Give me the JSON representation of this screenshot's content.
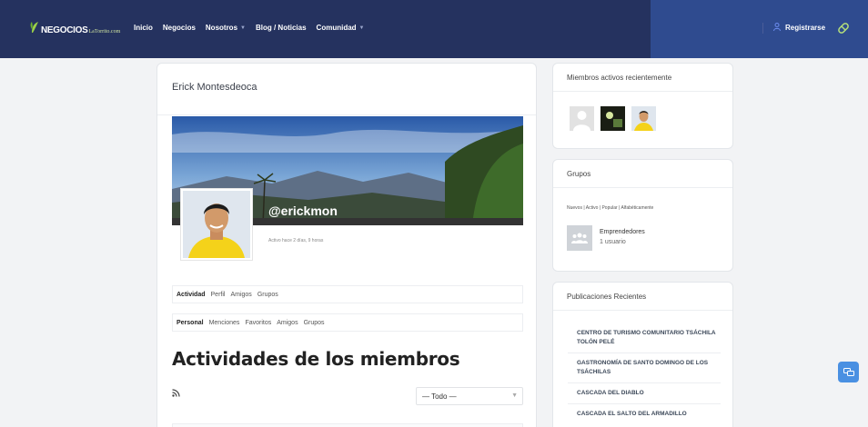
{
  "header": {
    "logo_brand": "NEGOCIOS",
    "logo_domain": "LaTorrito.com",
    "nav": [
      {
        "label": "Inicio",
        "dropdown": false
      },
      {
        "label": "Negocios",
        "dropdown": false
      },
      {
        "label": "Nosotros",
        "dropdown": true
      },
      {
        "label": "Blog / Noticias",
        "dropdown": false
      },
      {
        "label": "Comunidad",
        "dropdown": true
      }
    ],
    "register_label": "Registrarse",
    "register_icon": "user-icon",
    "pill_icon": "pill-icon"
  },
  "profile": {
    "name": "Erick Montesdeoca",
    "handle": "@erickmon",
    "last_active": "Activo hace 2 días, 9 horas",
    "tabs": [
      "Actividad",
      "Perfil",
      "Amigos",
      "Grupos"
    ],
    "active_tab": "Actividad",
    "subtabs": [
      "Personal",
      "Menciones",
      "Favoritos",
      "Amigos",
      "Grupos"
    ],
    "active_subtab": "Personal",
    "heading": "Actividades de los miembros",
    "rss_icon": "rss-icon",
    "filter_value": "— Todo —"
  },
  "sidebar": {
    "members_title": "Miembros activos recientemente",
    "groups_title": "Grupos",
    "groups_filters": "Nuevos | Activo | Popular | Alfabéticamente",
    "group_name": "Emprendedores",
    "group_members": "1 usuario",
    "posts_title": "Publicaciones Recientes",
    "posts": [
      "CENTRO DE TURISMO COMUNITARIO TSÁCHILA TOLÓN PELÉ",
      "GASTRONOMÍA DE SANTO DOMINGO DE LOS TSÁCHILAS",
      "CASCADA DEL DIABLO",
      "CASCADA EL SALTO DEL ARMADILLO"
    ]
  },
  "colors": {
    "topbar": "#25325f",
    "topbar_right": "#2f4b8f",
    "accent": "#4a90e2"
  }
}
